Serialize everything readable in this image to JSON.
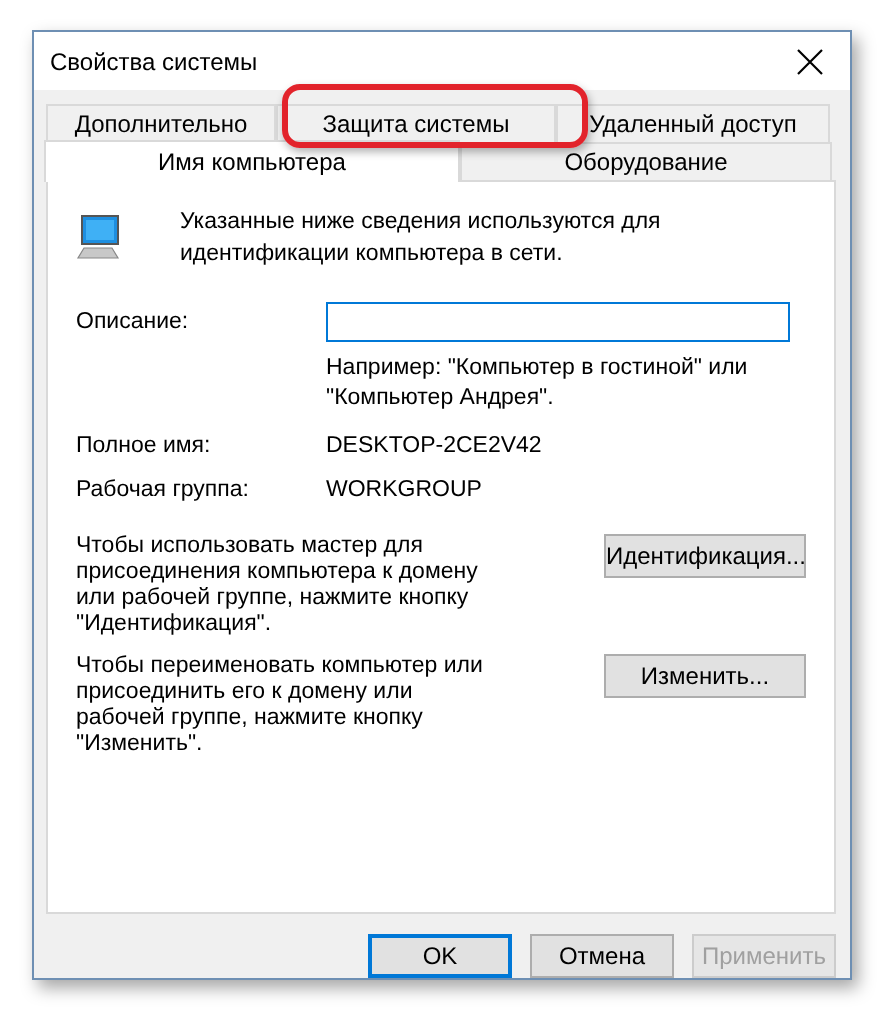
{
  "window": {
    "title": "Свойства системы"
  },
  "tab_rows": [
    {
      "tabs": [
        {
          "label": "Дополнительно",
          "selected": false,
          "highlighted": false
        },
        {
          "label": "Защита системы",
          "selected": false,
          "highlighted": true
        },
        {
          "label": "Удаленный доступ",
          "selected": false,
          "highlighted": false
        }
      ]
    },
    {
      "tabs": [
        {
          "label": "Имя компьютера",
          "selected": true,
          "highlighted": false
        },
        {
          "label": "Оборудование",
          "selected": false,
          "highlighted": false
        }
      ]
    }
  ],
  "intro": "Указанные ниже сведения используются для идентификации компьютера в сети.",
  "fields": [
    {
      "kind": "input",
      "label": "Описание:",
      "hint": "Например: \"Компьютер в гостиной\" или \"Компьютер Андрея\"."
    },
    {
      "kind": "value",
      "label": "Полное имя:",
      "value": "DESKTOP-2CE2V42"
    },
    {
      "kind": "value",
      "label": "Рабочая группа:",
      "value": "WORKGROUP"
    }
  ],
  "actions": [
    {
      "text": "Чтобы использовать мастер для присоединения компьютера к домену или рабочей группе, нажмите кнопку \"Идентификация\".",
      "button": "Идентификация..."
    },
    {
      "text": "Чтобы переименовать компьютер или присоединить его к домену или рабочей группе, нажмите кнопку \"Изменить\".",
      "button": "Изменить..."
    }
  ],
  "footer_buttons": [
    {
      "label": "OK",
      "default": true,
      "disabled": false
    },
    {
      "label": "Отмена",
      "default": false,
      "disabled": false
    },
    {
      "label": "Применить",
      "default": false,
      "disabled": true
    }
  ]
}
